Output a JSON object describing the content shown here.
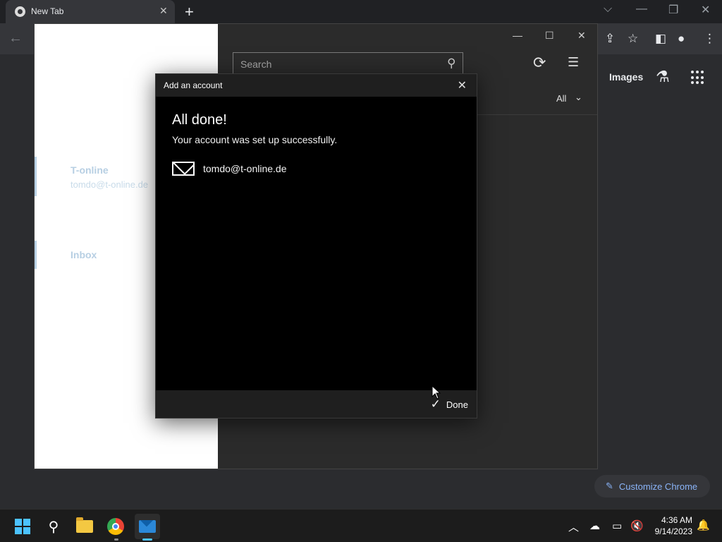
{
  "browser": {
    "tab_title": "New Tab",
    "tab_close": "✕",
    "new_tab": "+",
    "images_link": "Images",
    "customize_label": "Customize Chrome"
  },
  "mail": {
    "account_name": "T-online",
    "account_email": "tomdo@t-online.de",
    "inbox_label": "Inbox",
    "search_placeholder": "Search",
    "filter_label": "All"
  },
  "dialog": {
    "title": "Add an account",
    "heading": "All done!",
    "message": "Your account was set up successfully.",
    "account_email": "tomdo@t-online.de",
    "done_label": "Done"
  },
  "taskbar": {
    "time": "4:36 AM",
    "date": "9/14/2023"
  },
  "colors": {
    "accent": "#4cc2ff",
    "link_blue": "#8ab4f8",
    "dialog_bg": "#000000"
  }
}
